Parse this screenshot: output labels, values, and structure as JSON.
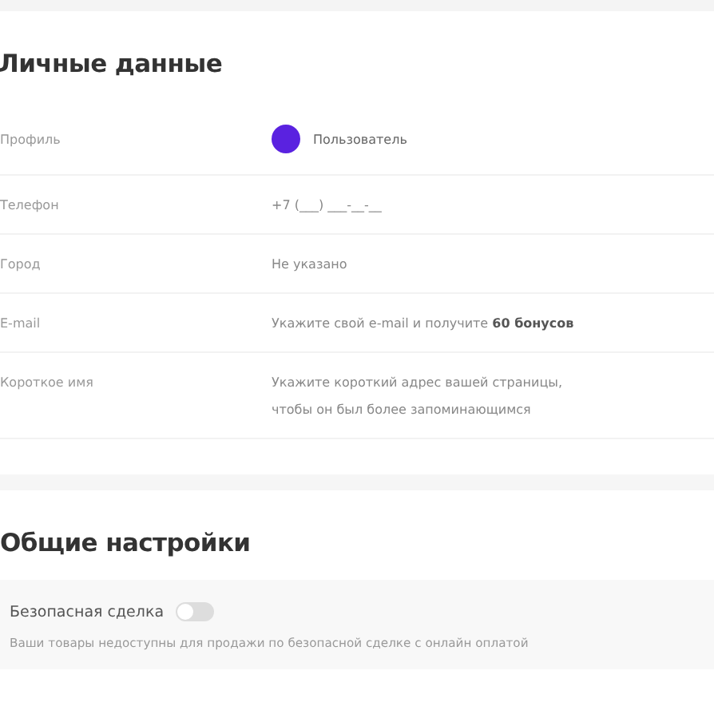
{
  "personal": {
    "title": "Личные данные",
    "rows": [
      {
        "kind": "profile",
        "label": "Профиль",
        "value": "Пользователь",
        "color": "#5a22e0"
      },
      {
        "kind": "text",
        "label": "Телефон",
        "value": "+7 (___) ___-__-__"
      },
      {
        "kind": "text",
        "label": "Город",
        "value": "Не указано"
      },
      {
        "kind": "text",
        "label": "E-mail",
        "value": "Укажите свой e-mail и получите **60 бонусов**"
      },
      {
        "kind": "text",
        "label": "Короткое имя",
        "value": "Укажите короткий адрес вашей страницы, чтобы он был более запоминающимся"
      }
    ]
  },
  "general": {
    "title": "Общие настройки",
    "setting": {
      "label": "Безопасная сделка",
      "on": false
    },
    "note": "Ваши товары недоступны для продажи по безопасной сделке с онлайн оплатой"
  }
}
